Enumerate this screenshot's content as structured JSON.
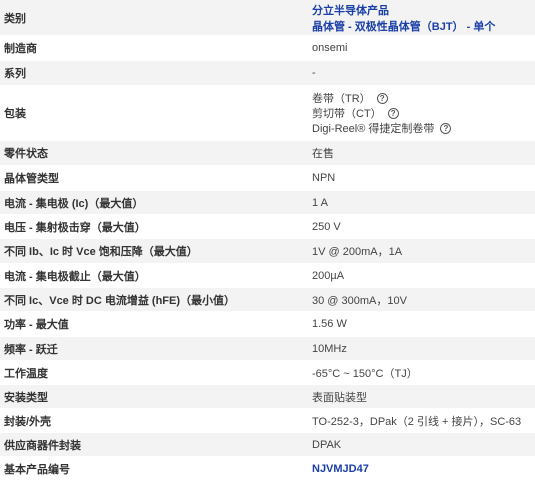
{
  "rows": [
    {
      "label": "类别",
      "value_lines": [
        "分立半导体产品",
        "晶体管 - 双极性晶体管（BJT） - 单个"
      ],
      "link": true
    },
    {
      "label": "制造商",
      "value": "onsemi"
    },
    {
      "label": "系列",
      "value": "-"
    },
    {
      "label": "包装",
      "packaging": [
        "卷带（TR）",
        "剪切带（CT）",
        "Digi-Reel® 得捷定制卷带"
      ]
    },
    {
      "label": "零件状态",
      "value": "在售"
    },
    {
      "label": "晶体管类型",
      "value": "NPN"
    },
    {
      "label": "电流 - 集电极 (Ic)（最大值）",
      "value": "1 A"
    },
    {
      "label": "电压 - 集射极击穿（最大值）",
      "value": "250 V"
    },
    {
      "label": "不同 Ib、Ic 时 Vce 饱和压降（最大值）",
      "value": "1V @ 200mA，1A"
    },
    {
      "label": "电流 - 集电极截止（最大值）",
      "value": "200µA"
    },
    {
      "label": "不同 Ic、Vce 时 DC 电流增益 (hFE)（最小值）",
      "value": "30 @ 300mA，10V"
    },
    {
      "label": "功率 - 最大值",
      "value": "1.56 W"
    },
    {
      "label": "频率 - 跃迁",
      "value": "10MHz"
    },
    {
      "label": "工作温度",
      "value": "-65°C ~ 150°C（TJ）"
    },
    {
      "label": "安装类型",
      "value": "表面贴装型"
    },
    {
      "label": "封装/外壳",
      "value": "TO-252-3，DPak（2 引线 + 接片），SC-63"
    },
    {
      "label": "供应商器件封装",
      "value": "DPAK"
    },
    {
      "label": "基本产品编号",
      "value": "NJVMJD47",
      "link": true
    }
  ],
  "help_icon_glyph": "?",
  "colors": {
    "link": "#1a3fa8",
    "row_alt": "#f3f3f3"
  }
}
